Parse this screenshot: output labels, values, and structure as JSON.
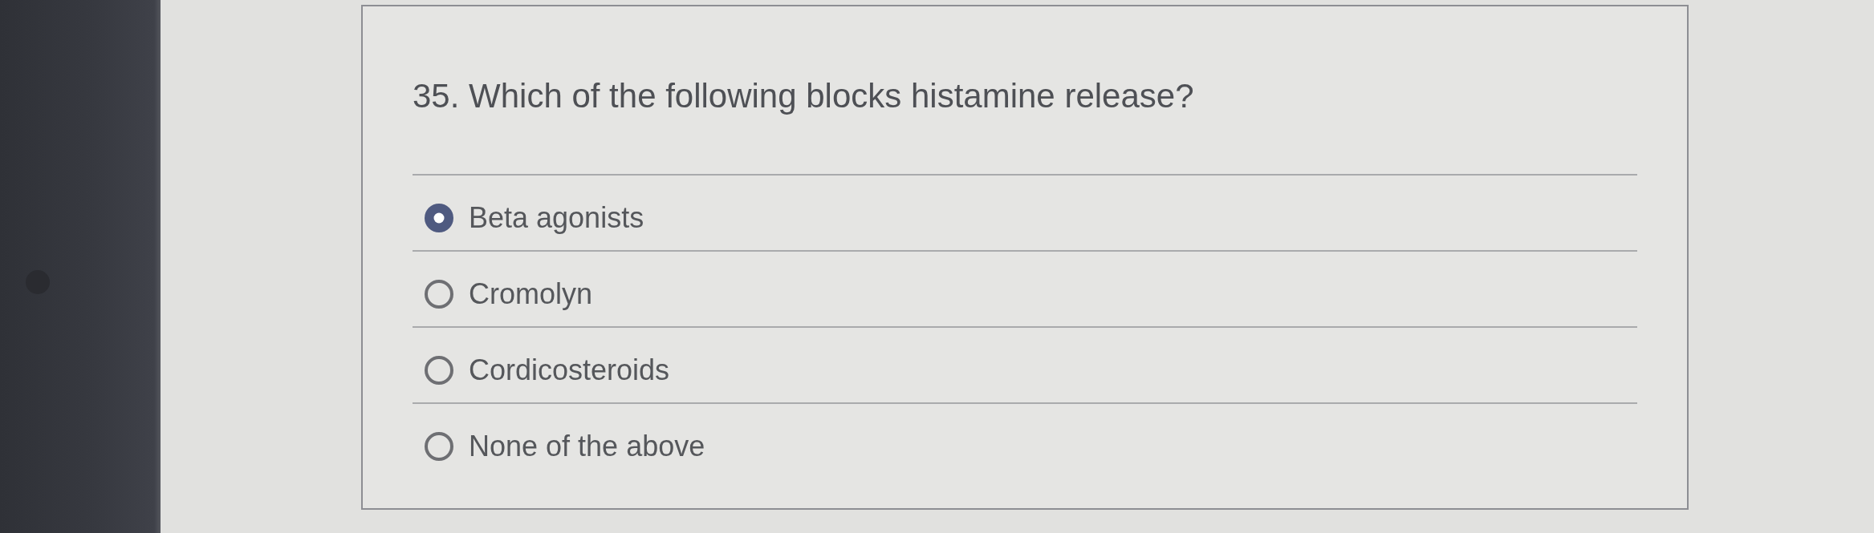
{
  "question": {
    "text": "35. Which of the following blocks histamine release?"
  },
  "options": [
    {
      "label": "Beta agonists",
      "selected": true
    },
    {
      "label": "Cromolyn",
      "selected": false
    },
    {
      "label": "Cordicosteroids",
      "selected": false
    },
    {
      "label": "None of the above",
      "selected": false
    }
  ]
}
